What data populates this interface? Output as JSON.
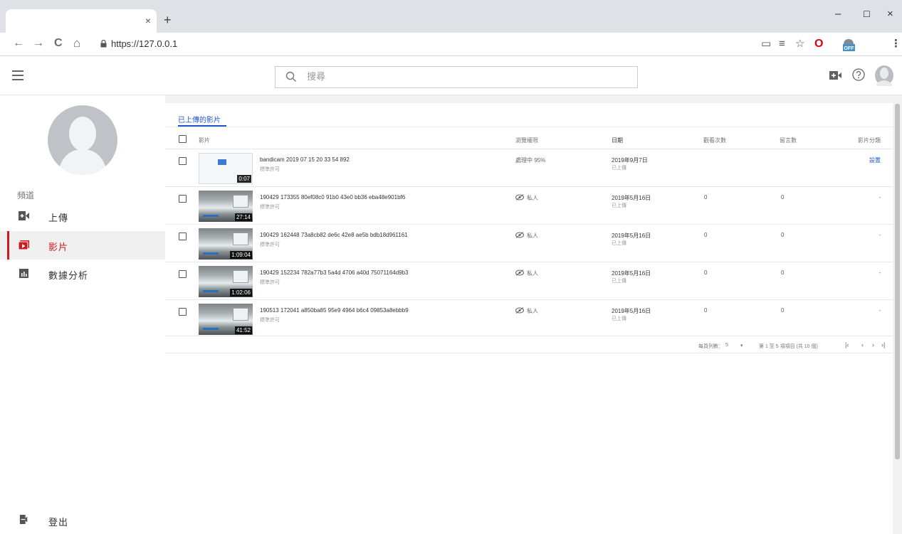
{
  "browser": {
    "tab_close": "×",
    "new_tab": "+",
    "window_controls": {
      "minimize": "–",
      "maximize": "☐",
      "close": "×"
    },
    "nav": {
      "back": "←",
      "forward": "→",
      "reload": "C",
      "home": "⌂"
    },
    "url": "https://127.0.0.1",
    "extension_icons": [
      "cast-icon",
      "reading-list-icon",
      "bookmark-star-icon",
      "opera-icon",
      "adblock-off-icon",
      "menu-dots-icon"
    ],
    "extension_glyphs": {
      "cast": "▭",
      "list": "≡",
      "star": "☆",
      "opera": "O",
      "menu": "⋮"
    },
    "adblock_label": "OFF"
  },
  "header": {
    "search_placeholder": "搜尋",
    "icons": [
      "menu-icon",
      "create-video-icon",
      "help-icon",
      "account-avatar-icon"
    ]
  },
  "sidebar": {
    "section_label": "頻道",
    "items": [
      {
        "icon": "upload-icon",
        "label": "上傳",
        "active": false
      },
      {
        "icon": "videos-icon",
        "label": "影片",
        "active": true
      },
      {
        "icon": "analytics-icon",
        "label": "數據分析",
        "active": false
      }
    ],
    "logout": {
      "icon": "logout-icon",
      "label": "登出"
    }
  },
  "main": {
    "tab": "已上傳的影片",
    "columns": {
      "video": "影片",
      "visibility": "瀏覽權限",
      "date": "日期",
      "views": "觀看次數",
      "comments": "留言數",
      "category": "影片分類"
    },
    "rows": [
      {
        "title": "bandicam 2019 07 15 20 33 54 892",
        "sub": "標準許可",
        "duration": "0:07",
        "visibility": "處理中 95%",
        "private": false,
        "date": "2019年9月7日",
        "date_status": "已上傳",
        "views": "",
        "comments": "",
        "category": "設置",
        "category_link": true
      },
      {
        "title": "190429 173355 80ef08c0 91b0 43e0 bb36 eba48e901bf6",
        "sub": "標準許可",
        "duration": "27:14",
        "visibility": "私人",
        "private": true,
        "date": "2019年5月16日",
        "date_status": "已上傳",
        "views": "0",
        "comments": "0",
        "category": "-",
        "category_link": false
      },
      {
        "title": "190429 162448 73a8cb82 de6c 42e8 ae5b bdb18d961161",
        "sub": "標準許可",
        "duration": "1:09:04",
        "visibility": "私人",
        "private": true,
        "date": "2019年5月16日",
        "date_status": "已上傳",
        "views": "0",
        "comments": "0",
        "category": "-",
        "category_link": false
      },
      {
        "title": "190429 152234 782a77b3 5a4d 4706 a40d 75071164d9b3",
        "sub": "標準許可",
        "duration": "1:02:06",
        "visibility": "私人",
        "private": true,
        "date": "2019年5月16日",
        "date_status": "已上傳",
        "views": "0",
        "comments": "0",
        "category": "-",
        "category_link": false
      },
      {
        "title": "190513 172041 a850ba85 95e9 4964 b6c4 09853a8ebbb9",
        "sub": "標準許可",
        "duration": "41:52",
        "visibility": "私人",
        "private": true,
        "date": "2019年5月16日",
        "date_status": "已上傳",
        "views": "0",
        "comments": "0",
        "category": "-",
        "category_link": false
      }
    ],
    "pagination": {
      "rows_per_page_label": "每頁列數：",
      "rows_per_page": "5",
      "dropdown": "▾",
      "range": "第 1 至 5 項項目 (共 10 個)",
      "first": "|‹",
      "prev": "‹",
      "next": "›",
      "last": "›|"
    }
  },
  "colors": {
    "accent_red": "#cc181e",
    "link_blue": "#1a57c8"
  }
}
